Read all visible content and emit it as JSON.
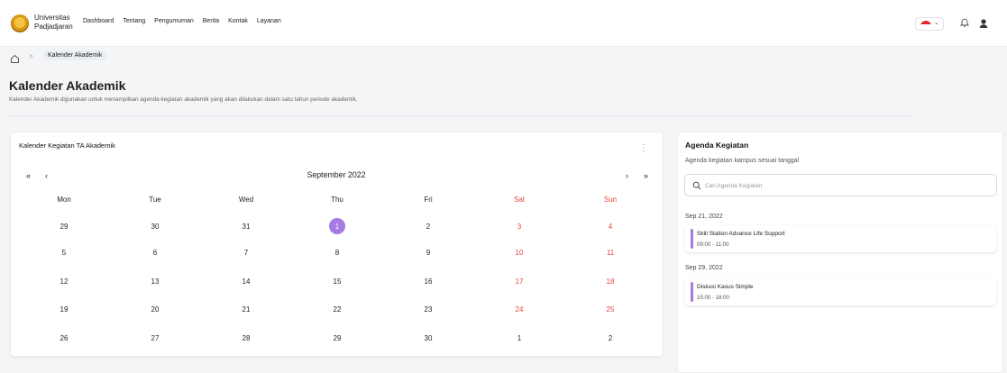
{
  "brand": {
    "line1": "Universitas",
    "line2": "Padjadjaran"
  },
  "nav": [
    "Dashboard",
    "Tentang",
    "Pengumuman",
    "Berita",
    "Kontak",
    "Layanan"
  ],
  "header": {
    "language_icon": "flag-indonesia-icon",
    "notification_icon": "bell-icon",
    "profile_icon": "user-icon",
    "chevron": "⌄"
  },
  "breadcrumb": {
    "current": "Kalender Akademik",
    "separator": ">"
  },
  "page": {
    "title": "Kalender Akademik",
    "description": "Kalender Akademik digunakan untuk menampilkan agenda kegiatan akademik yang akan dilakukan dalam satu tahun periode akademik."
  },
  "calendar": {
    "title": "Kalender Kegiatan TA Akademik",
    "month_label": "September 2022",
    "menu": "⋮",
    "nav": {
      "first": "«",
      "prev": "‹",
      "next": "›",
      "last": "»"
    },
    "weekdays": [
      "Mon",
      "Tue",
      "Wed",
      "Thu",
      "Fri",
      "Sat",
      "Sun"
    ],
    "weeks": [
      [
        "29",
        "30",
        "31",
        "1",
        "2",
        "3",
        "4"
      ],
      [
        "5",
        "6",
        "7",
        "8",
        "9",
        "10",
        "11"
      ],
      [
        "12",
        "13",
        "14",
        "15",
        "16",
        "17",
        "18"
      ],
      [
        "19",
        "20",
        "21",
        "22",
        "23",
        "24",
        "25"
      ],
      [
        "26",
        "27",
        "28",
        "29",
        "30",
        "1",
        "2"
      ]
    ],
    "highlight": {
      "week": 0,
      "day": 3
    }
  },
  "agenda": {
    "title": "Agenda Kegiatan",
    "subtitle": "Agenda kegiatan kampus sesuai tanggal",
    "search_placeholder": "Cari Agenda Kegiatan",
    "groups": [
      {
        "date": "Sep 21, 2022",
        "name": "Skill Station Advance Life Support",
        "time": "09:00 - 11:00"
      },
      {
        "date": "Sep 29, 2022",
        "name": "Diskusi Kasus Simple",
        "time": "15:00 - 18:00"
      }
    ]
  },
  "colors": {
    "accent": "#a57be2",
    "weekend": "#e8463f",
    "text": "#222222"
  }
}
